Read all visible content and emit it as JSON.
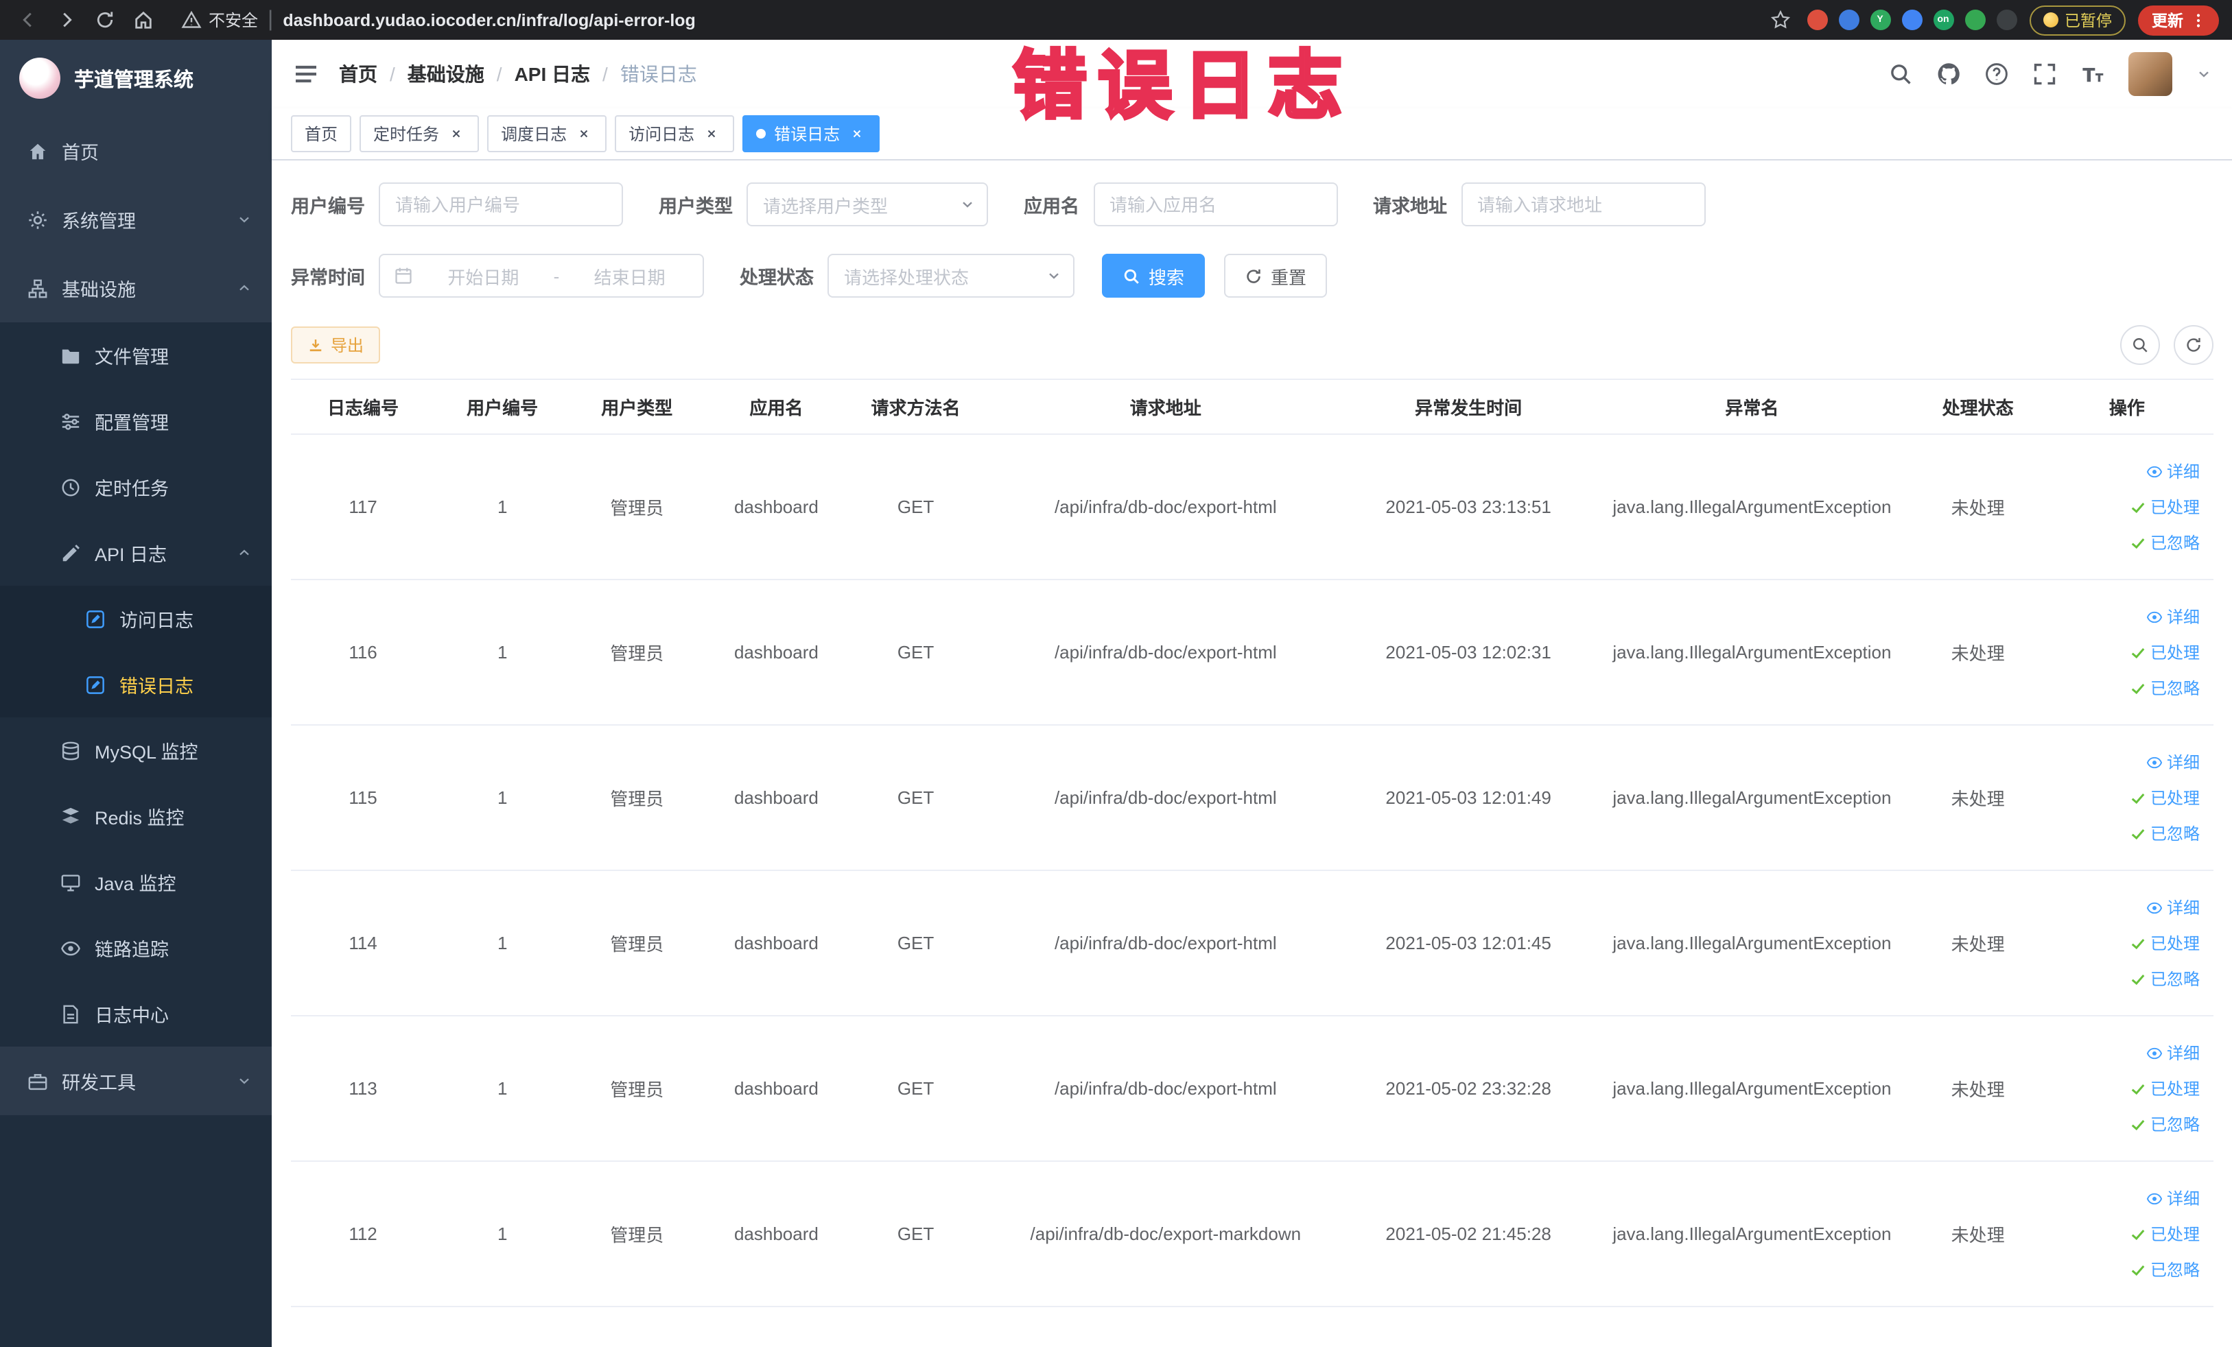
{
  "colors": {
    "accent": "#409eff",
    "success": "#67c23a",
    "warning": "#e6a23c",
    "sidebar_bg": "#2d3a4b",
    "sidebar_submenu_bg": "#1f2d3d",
    "active_menu_text": "#ffd04b",
    "watermark_red": "#e73053",
    "update_button_red": "#d33a2f"
  },
  "browser": {
    "security_label": "不安全",
    "url": "dashboard.yudao.iocoder.cn/infra/log/api-error-log",
    "paused_label": "已暂停",
    "update_label": "更新",
    "extensions": [
      {
        "name": "extension-red-circle-icon",
        "color": "#dd4f3e",
        "label": ""
      },
      {
        "name": "extension-blue-drop-icon",
        "color": "#3f7de0",
        "label": ""
      },
      {
        "name": "extension-green-y-icon",
        "color": "#2faa5e",
        "label": "Y"
      },
      {
        "name": "extension-blue-grid-icon",
        "color": "#4285f4",
        "label": ""
      },
      {
        "name": "extension-on-badge-icon",
        "color": "#1fa463",
        "label": "on"
      },
      {
        "name": "extension-leaf-icon",
        "color": "#35a853",
        "label": ""
      },
      {
        "name": "extension-pin-icon",
        "color": "#3c4043",
        "label": ""
      }
    ]
  },
  "watermark": "错误日志",
  "sidebar": {
    "app_title": "芋道管理系统",
    "items": [
      {
        "key": "home",
        "label": "首页",
        "icon": "home-icon",
        "type": "item"
      },
      {
        "key": "system",
        "label": "系统管理",
        "icon": "gear-icon",
        "type": "group",
        "expanded": false
      },
      {
        "key": "infra",
        "label": "基础设施",
        "icon": "infra-icon",
        "type": "group",
        "expanded": true
      },
      {
        "key": "file",
        "label": "文件管理",
        "icon": "folder-icon",
        "type": "subitem"
      },
      {
        "key": "config",
        "label": "配置管理",
        "icon": "sliders-icon",
        "type": "subitem"
      },
      {
        "key": "job",
        "label": "定时任务",
        "icon": "clock-icon",
        "type": "subitem"
      },
      {
        "key": "api-log",
        "label": "API 日志",
        "icon": "edit-icon",
        "type": "subgroup",
        "expanded": true
      },
      {
        "key": "access-log",
        "label": "访问日志",
        "icon": "doc-edit-icon",
        "type": "subsubitem",
        "icon_color": "#409eff"
      },
      {
        "key": "error-log",
        "label": "错误日志",
        "icon": "doc-edit-icon",
        "type": "subsubitem",
        "icon_color": "#409eff",
        "active": true
      },
      {
        "key": "mysql",
        "label": "MySQL 监控",
        "icon": "database-icon",
        "type": "subitem"
      },
      {
        "key": "redis",
        "label": "Redis 监控",
        "icon": "layers-icon",
        "type": "subitem"
      },
      {
        "key": "java",
        "label": "Java 监控",
        "icon": "monitor-icon",
        "type": "subitem"
      },
      {
        "key": "trace",
        "label": "链路追踪",
        "icon": "eye-icon",
        "type": "subitem"
      },
      {
        "key": "log-center",
        "label": "日志中心",
        "icon": "doc-icon",
        "type": "subitem"
      },
      {
        "key": "dev-tools",
        "label": "研发工具",
        "icon": "briefcase-icon",
        "type": "group",
        "expanded": false
      }
    ]
  },
  "header": {
    "breadcrumb": [
      "首页",
      "基础设施",
      "API 日志",
      "错误日志"
    ]
  },
  "tabs": [
    {
      "key": "home",
      "label": "首页",
      "closable": false,
      "active": false
    },
    {
      "key": "job",
      "label": "定时任务",
      "closable": true,
      "active": false
    },
    {
      "key": "job-log",
      "label": "调度日志",
      "closable": true,
      "active": false
    },
    {
      "key": "access-log",
      "label": "访问日志",
      "closable": true,
      "active": false
    },
    {
      "key": "error-log",
      "label": "错误日志",
      "closable": true,
      "active": true
    }
  ],
  "filters": {
    "user_id": {
      "label": "用户编号",
      "placeholder": "请输入用户编号"
    },
    "user_type": {
      "label": "用户类型",
      "placeholder": "请选择用户类型"
    },
    "app_name": {
      "label": "应用名",
      "placeholder": "请输入应用名"
    },
    "request_url": {
      "label": "请求地址",
      "placeholder": "请输入请求地址"
    },
    "exception_time": {
      "label": "异常时间",
      "start_placeholder": "开始日期",
      "separator": "-",
      "end_placeholder": "结束日期"
    },
    "process_status": {
      "label": "处理状态",
      "placeholder": "请选择处理状态"
    },
    "search_label": "搜索",
    "reset_label": "重置"
  },
  "toolbar": {
    "export_label": "导出"
  },
  "table": {
    "columns": [
      "日志编号",
      "用户编号",
      "用户类型",
      "应用名",
      "请求方法名",
      "请求地址",
      "异常发生时间",
      "异常名",
      "处理状态",
      "操作"
    ],
    "actions": {
      "detail": "详细",
      "processed": "已处理",
      "ignored": "已忽略"
    },
    "rows": [
      {
        "id": "117",
        "user_id": "1",
        "user_type": "管理员",
        "app": "dashboard",
        "method": "GET",
        "url": "/api/infra/db-doc/export-html",
        "time": "2021-05-03 23:13:51",
        "exception": "java.lang.IllegalArgumentException",
        "status": "未处理"
      },
      {
        "id": "116",
        "user_id": "1",
        "user_type": "管理员",
        "app": "dashboard",
        "method": "GET",
        "url": "/api/infra/db-doc/export-html",
        "time": "2021-05-03 12:02:31",
        "exception": "java.lang.IllegalArgumentException",
        "status": "未处理"
      },
      {
        "id": "115",
        "user_id": "1",
        "user_type": "管理员",
        "app": "dashboard",
        "method": "GET",
        "url": "/api/infra/db-doc/export-html",
        "time": "2021-05-03 12:01:49",
        "exception": "java.lang.IllegalArgumentException",
        "status": "未处理"
      },
      {
        "id": "114",
        "user_id": "1",
        "user_type": "管理员",
        "app": "dashboard",
        "method": "GET",
        "url": "/api/infra/db-doc/export-html",
        "time": "2021-05-03 12:01:45",
        "exception": "java.lang.IllegalArgumentException",
        "status": "未处理"
      },
      {
        "id": "113",
        "user_id": "1",
        "user_type": "管理员",
        "app": "dashboard",
        "method": "GET",
        "url": "/api/infra/db-doc/export-html",
        "time": "2021-05-02 23:32:28",
        "exception": "java.lang.IllegalArgumentException",
        "status": "未处理"
      },
      {
        "id": "112",
        "user_id": "1",
        "user_type": "管理员",
        "app": "dashboard",
        "method": "GET",
        "url": "/api/infra/db-doc/export-markdown",
        "time": "2021-05-02 21:45:28",
        "exception": "java.lang.IllegalArgumentException",
        "status": "未处理"
      }
    ]
  }
}
